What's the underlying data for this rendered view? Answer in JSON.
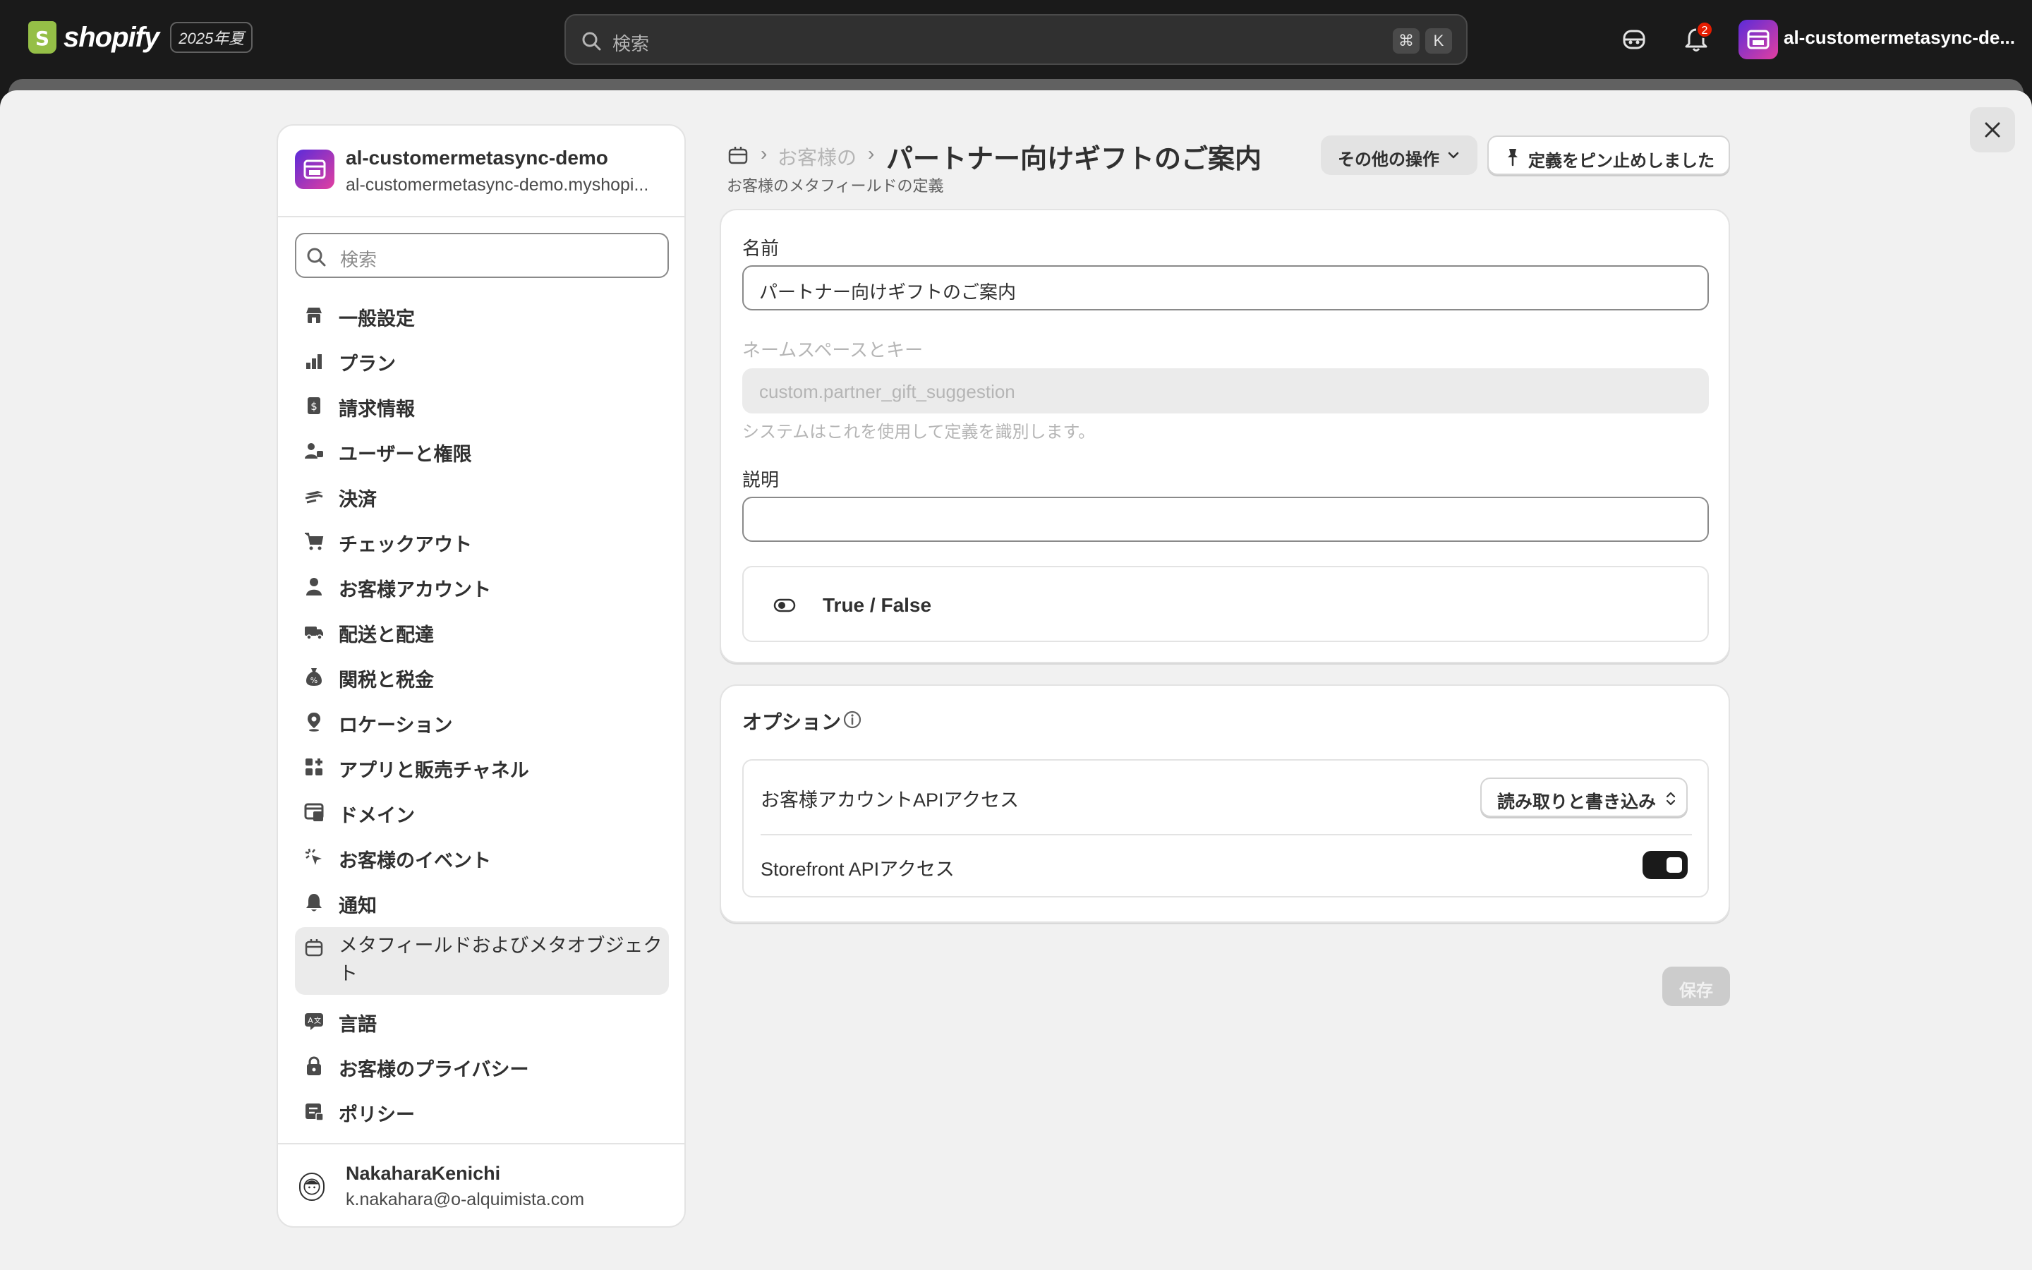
{
  "topbar": {
    "brand": "shopify",
    "edition_badge": "2025年夏",
    "search_placeholder": "検索",
    "shortcut_keys": [
      "⌘",
      "K"
    ],
    "notification_count": "2",
    "store_name": "al-customermetasync-de..."
  },
  "sidebar": {
    "store_name": "al-customermetasync-demo",
    "store_url": "al-customermetasync-demo.myshopi...",
    "search_placeholder": "検索",
    "items": [
      {
        "label": "一般設定",
        "icon": "store-icon"
      },
      {
        "label": "プラン",
        "icon": "plan-icon"
      },
      {
        "label": "請求情報",
        "icon": "billing-icon"
      },
      {
        "label": "ユーザーと権限",
        "icon": "users-icon"
      },
      {
        "label": "決済",
        "icon": "payments-icon"
      },
      {
        "label": "チェックアウト",
        "icon": "cart-icon"
      },
      {
        "label": "お客様アカウント",
        "icon": "person-icon"
      },
      {
        "label": "配送と配達",
        "icon": "truck-icon"
      },
      {
        "label": "関税と税金",
        "icon": "tax-icon"
      },
      {
        "label": "ロケーション",
        "icon": "location-icon"
      },
      {
        "label": "アプリと販売チャネル",
        "icon": "apps-icon"
      },
      {
        "label": "ドメイン",
        "icon": "domain-icon"
      },
      {
        "label": "お客様のイベント",
        "icon": "cursor-icon"
      },
      {
        "label": "通知",
        "icon": "bell-icon"
      },
      {
        "label": "メタフィールドおよびメタオブジェクト",
        "icon": "metafields-icon",
        "active": true
      },
      {
        "label": "言語",
        "icon": "language-icon"
      },
      {
        "label": "お客様のプライバシー",
        "icon": "lock-icon"
      },
      {
        "label": "ポリシー",
        "icon": "policy-icon"
      }
    ],
    "user": {
      "name": "NakaharaKenichi",
      "email": "k.nakahara@o-alquimista.com"
    }
  },
  "header": {
    "breadcrumb_parent": "お客様のメタフィールド定義",
    "title": "パートナー向けギフトのご案内",
    "subtitle": "お客様のメタフィールドの定義",
    "more_actions_label": "その他の操作",
    "pin_label": "定義をピン止めしました"
  },
  "definition": {
    "name_label": "名前",
    "name_value": "パートナー向けギフトのご案内",
    "namespace_label": "ネームスペースとキー",
    "namespace_value": "custom.partner_gift_suggestion",
    "namespace_help": "システムはこれを使用して定義を識別します。",
    "description_label": "説明",
    "description_value": "",
    "type_label": "True / False"
  },
  "options": {
    "title": "オプション",
    "customer_api_label": "お客様アカウントAPIアクセス",
    "customer_api_value": "読み取りと書き込み",
    "storefront_api_label": "Storefront APIアクセス",
    "storefront_api_enabled": true
  },
  "footer": {
    "save_label": "保存"
  },
  "colors": {
    "topbar_bg": "#1a1a1a",
    "page_bg": "#f1f1f1",
    "card_bg": "#ffffff",
    "toggle_on": "#1a1a1a",
    "badge_red": "#e51c00"
  }
}
